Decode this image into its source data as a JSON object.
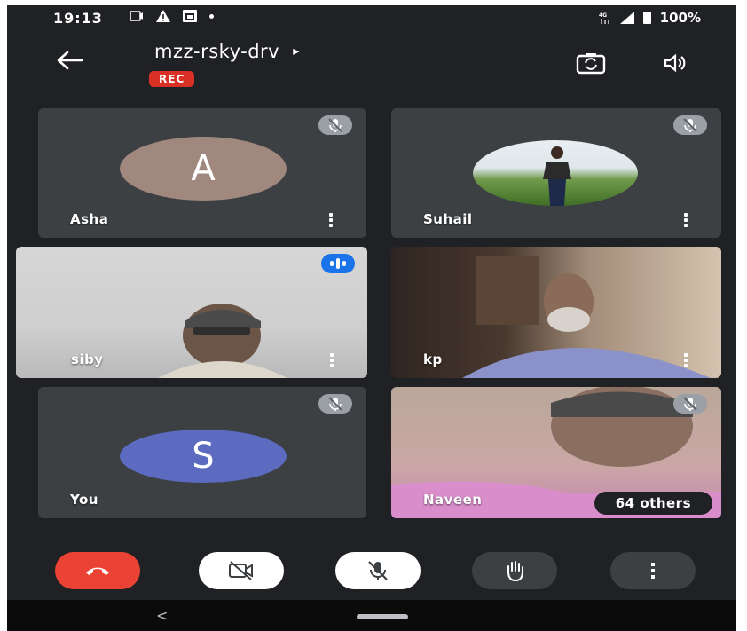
{
  "status_bar": {
    "time": "19:13",
    "battery": "100%"
  },
  "header": {
    "back_icon": "arrow-left-icon",
    "meeting_code": "mzz-rsky-drv",
    "meeting_code_arrow": "▸",
    "rec_badge": "REC",
    "switch_camera_icon": "switch-camera-icon",
    "speaker_icon": "speaker-icon"
  },
  "participants": [
    {
      "name": "Asha",
      "initial": "A",
      "avatar_color": "#a1887f",
      "muted": true
    },
    {
      "name": "Suhail",
      "type": "photo",
      "muted": true
    },
    {
      "name": "siby",
      "type": "video",
      "speaking": true
    },
    {
      "name": "kp",
      "type": "video"
    },
    {
      "name": "You",
      "initial": "S",
      "avatar_color": "#5c6bc0",
      "muted": true
    },
    {
      "name": "Naveen",
      "type": "video",
      "muted": true,
      "others_label": "64 others"
    }
  ],
  "controls": {
    "end_call_color": "#ea4335",
    "end_call_icon": "phone-hangup-icon",
    "camera_icon": "camera-off-icon",
    "mic_icon": "mic-off-icon",
    "hand_icon": "raise-hand-icon",
    "more_icon": "more-vertical-icon"
  },
  "nav": {
    "back_glyph": "<"
  }
}
